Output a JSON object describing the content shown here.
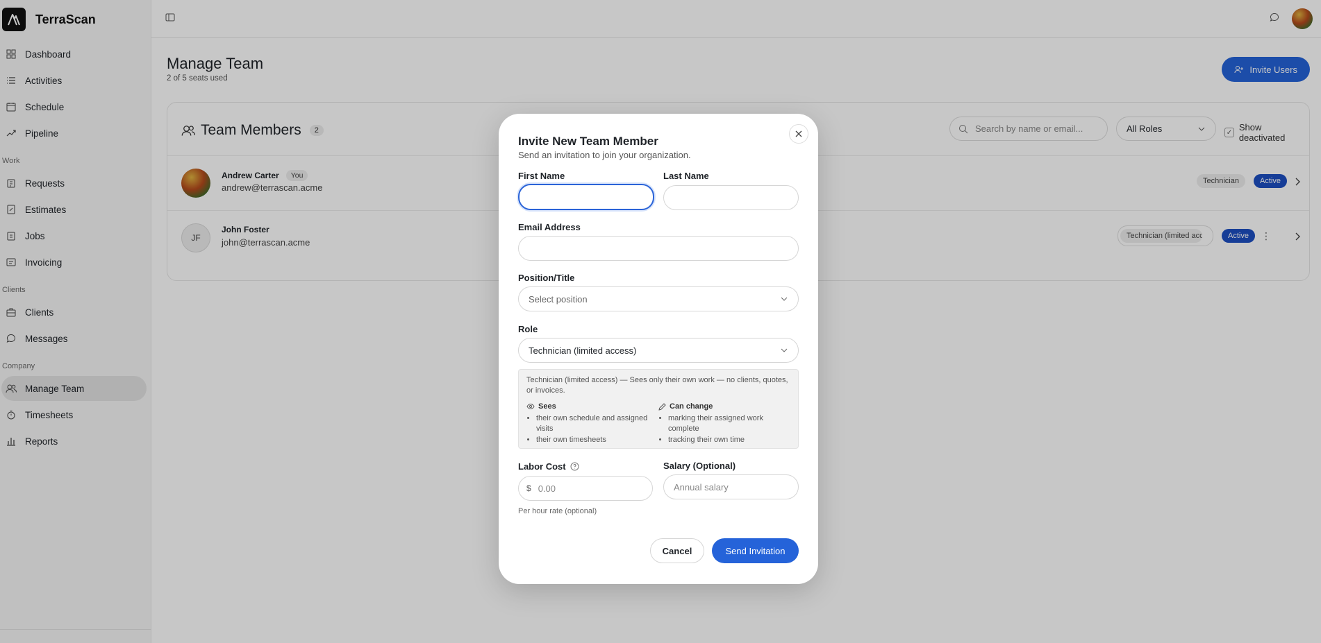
{
  "app": {
    "name": "TerraScan"
  },
  "sidebar": {
    "main_items": [
      {
        "label": "Dashboard",
        "icon": "grid-icon"
      },
      {
        "label": "Activities",
        "icon": "list-icon"
      },
      {
        "label": "Schedule",
        "icon": "calendar-icon"
      },
      {
        "label": "Pipeline",
        "icon": "trend-icon"
      }
    ],
    "work_section": "Work",
    "work_items": [
      {
        "label": "Requests",
        "icon": "clipboard-icon"
      },
      {
        "label": "Estimates",
        "icon": "estimate-icon"
      },
      {
        "label": "Jobs",
        "icon": "clipboard-icon"
      },
      {
        "label": "Invoicing",
        "icon": "invoice-icon"
      }
    ],
    "clients_section": "Clients",
    "clients_items": [
      {
        "label": "Clients",
        "icon": "briefcase-icon"
      },
      {
        "label": "Messages",
        "icon": "message-icon"
      }
    ],
    "company_section": "Company",
    "company_items": [
      {
        "label": "Manage Team",
        "icon": "users-icon",
        "active": true
      },
      {
        "label": "Timesheets",
        "icon": "timer-icon"
      },
      {
        "label": "Reports",
        "icon": "bar-chart-icon"
      }
    ]
  },
  "page": {
    "title": "Manage Team",
    "subtitle": "2 of 5 seats used",
    "invite_button": "Invite Users"
  },
  "team": {
    "title": "Team Members",
    "count": "2",
    "search_placeholder": "Search by name or email...",
    "role_filter": "All Roles",
    "show_deactivated": "Show deactivated",
    "members": [
      {
        "name": "Andrew Carter",
        "you": "You",
        "email": "andrew@terrascan.acme",
        "role": "Technician",
        "status": "Active"
      },
      {
        "initials": "JF",
        "name": "John Foster",
        "email": "john@terrascan.acme",
        "role": "Technician (limited access)",
        "status": "Active"
      }
    ]
  },
  "modal": {
    "title": "Invite New Team Member",
    "subtitle": "Send an invitation to join your organization.",
    "first_name_label": "First Name",
    "first_name_value": "",
    "last_name_label": "Last Name",
    "last_name_value": "",
    "email_label": "Email Address",
    "email_value": "",
    "position_label": "Position/Title",
    "position_placeholder": "Select position",
    "role_label": "Role",
    "role_value": "Technician (limited access)",
    "role_description": "Technician (limited access) — Sees only their own work — no clients, quotes, or invoices.",
    "sees_heading": "Sees",
    "sees_items": [
      "their own schedule and assigned visits",
      "their own timesheets"
    ],
    "can_change_heading": "Can change",
    "can_change_items": [
      "marking their assigned work complete",
      "tracking their own time"
    ],
    "labor_cost_label": "Labor Cost",
    "labor_currency": "$",
    "labor_placeholder": "0.00",
    "labor_hint": "Per hour rate (optional)",
    "salary_label": "Salary (Optional)",
    "salary_placeholder": "Annual salary",
    "cancel_label": "Cancel",
    "send_label": "Send Invitation"
  },
  "colors": {
    "accent": "#2563d9",
    "active_badge": "#1d4fc2",
    "overlay": "rgba(0,0,0,0.22)"
  }
}
